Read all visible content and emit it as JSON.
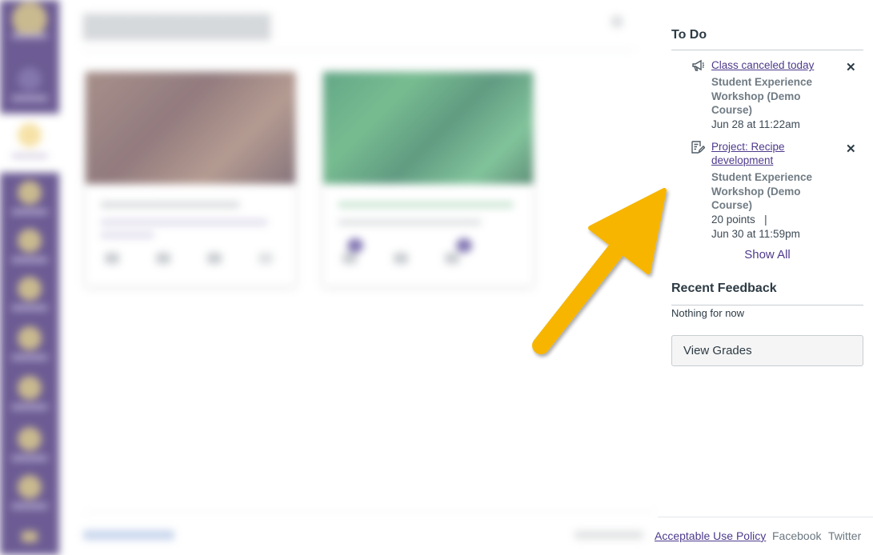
{
  "todo": {
    "heading": "To Do",
    "items": [
      {
        "icon": "announcement-icon",
        "title": "Class canceled today",
        "course": "Student Experience Workshop (Demo Course)",
        "points": "",
        "date": "Jun 28 at 11:22am",
        "close": "✕"
      },
      {
        "icon": "assignment-icon",
        "title": "Project: Recipe development",
        "course": "Student Experience Workshop (Demo Course)",
        "points": "20 points",
        "separator": "|",
        "date": "Jun 30 at 11:59pm",
        "close": "✕"
      }
    ],
    "show_all": "Show All"
  },
  "recent_feedback": {
    "heading": "Recent Feedback",
    "empty_text": "Nothing for now"
  },
  "view_grades_label": "View Grades",
  "footer": {
    "links": [
      "Acceptable Use Policy",
      "Facebook",
      "Twitter"
    ]
  },
  "colors": {
    "nav": "#3b2570",
    "link": "#4e3a8c",
    "arrow": "#f7b500"
  }
}
